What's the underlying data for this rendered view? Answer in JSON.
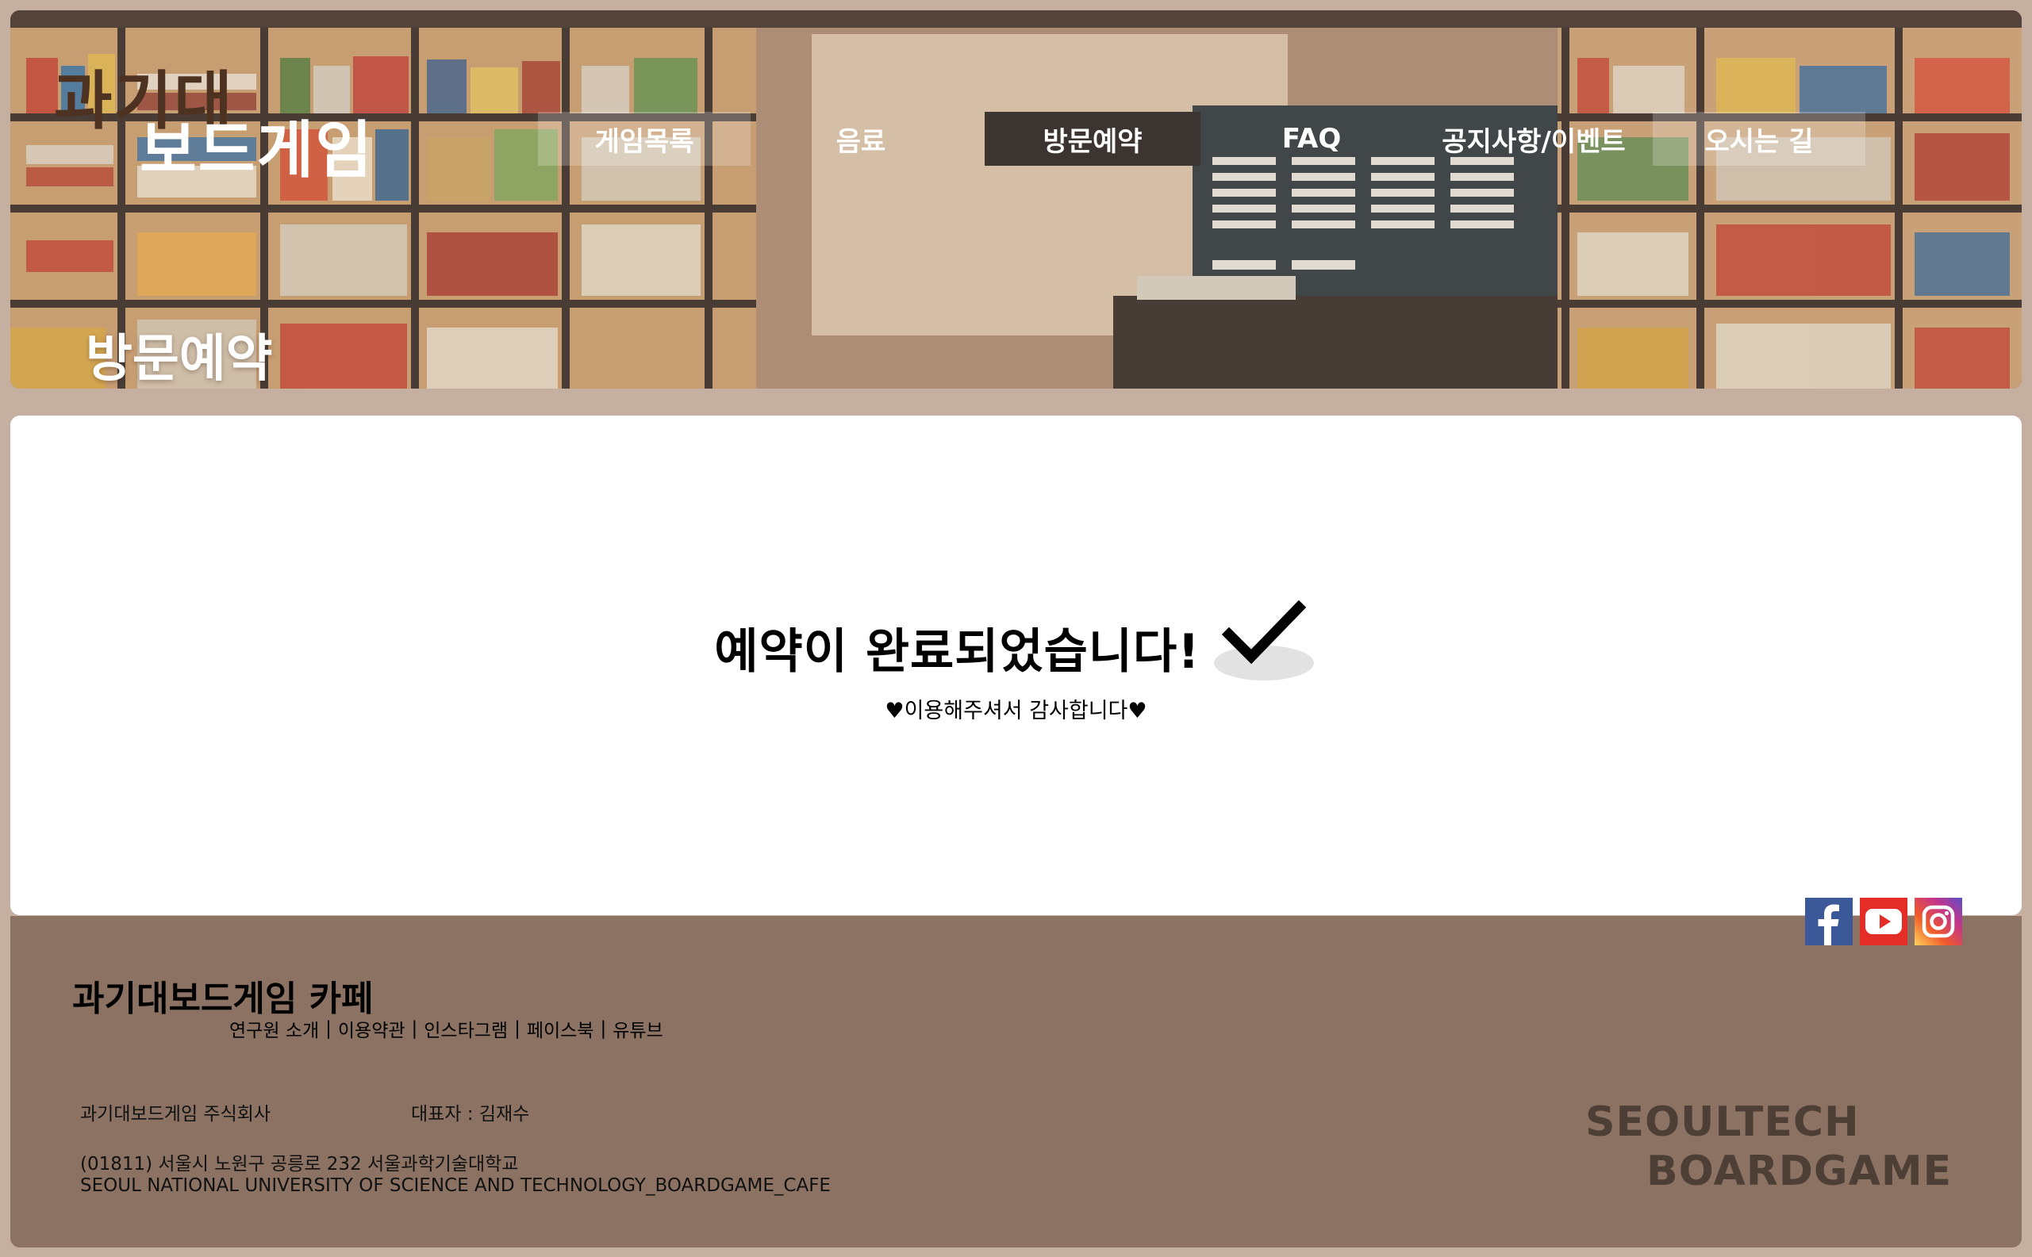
{
  "logo": {
    "line1": "과기대",
    "line2": "보드게임"
  },
  "nav": {
    "items": [
      {
        "label": "게임목록"
      },
      {
        "label": "음료"
      },
      {
        "label": "방문예약"
      },
      {
        "label": "FAQ"
      },
      {
        "label": "공지사항/이벤트"
      },
      {
        "label": "오시는 길"
      }
    ],
    "active": "방문예약"
  },
  "hero": {
    "title": "방문예약"
  },
  "confirmation": {
    "message": "예약이 완료되었습니다!",
    "thanks": "♥이용해주셔서 감사합니다♥",
    "icon": "checkmark-icon"
  },
  "footer": {
    "title": "과기대보드게임 카페",
    "links": [
      "연구원 소개",
      "이용약관",
      "인스타그램",
      "페이스북",
      "유튜브"
    ],
    "company": "과기대보드게임 주식회사",
    "ceo": "대표자 : 김재수",
    "address": "(01811) 서울시 노원구 공릉로 232 서울과학기술대학교",
    "address_en": "SEOUL NATIONAL UNIVERSITY OF SCIENCE AND TECHNOLOGY_BOARDGAME_CAFE",
    "brand_line1": "SEOULTECH",
    "brand_line2": "BOARDGAME",
    "social": [
      "facebook-icon",
      "youtube-icon",
      "instagram-icon"
    ]
  },
  "colors": {
    "page_bg": "#c4afa1",
    "footer_bg": "#8b7263",
    "nav_active_bg": "#3b3430",
    "facebook": "#3b5998",
    "youtube": "#e52d27",
    "instagram_gradient": [
      "#fdd55b",
      "#f1592a",
      "#c1358d",
      "#5b4fc8"
    ]
  }
}
